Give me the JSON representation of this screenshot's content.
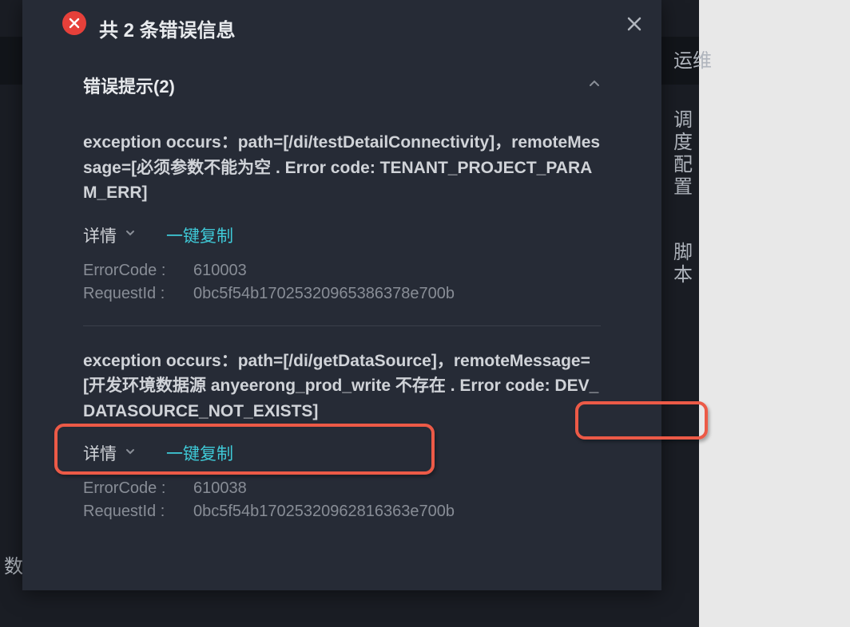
{
  "dialog": {
    "title": "共 2 条错误信息",
    "section_title": "错误提示(2)",
    "details_label": "详情",
    "copy_label": "一键复制",
    "error_code_label": "ErrorCode :",
    "request_id_label": "RequestId :",
    "errors": [
      {
        "message": "exception occurs：path=[/di/testDetailConnectivity]，remoteMessage=[必须参数不能为空 . Error code: TENANT_PROJECT_PARAM_ERR]",
        "error_code": "610003",
        "request_id": "0bc5f54b17025320965386378e700b"
      },
      {
        "message": "exception occurs：path=[/di/getDataSource]，remoteMessage=[开发环境数据源 anyeerong_prod_write 不存在 . Error code: DEV_DATASOURCE_NOT_EXISTS]",
        "error_code": "610038",
        "request_id": "0bc5f54b17025320962816363e700b"
      }
    ]
  },
  "bg": {
    "side1": "运维",
    "side2": "调",
    "side3": "度",
    "side4": "配",
    "side5": "置",
    "side6": "脚",
    "side7": "本",
    "bottom": "数字"
  }
}
